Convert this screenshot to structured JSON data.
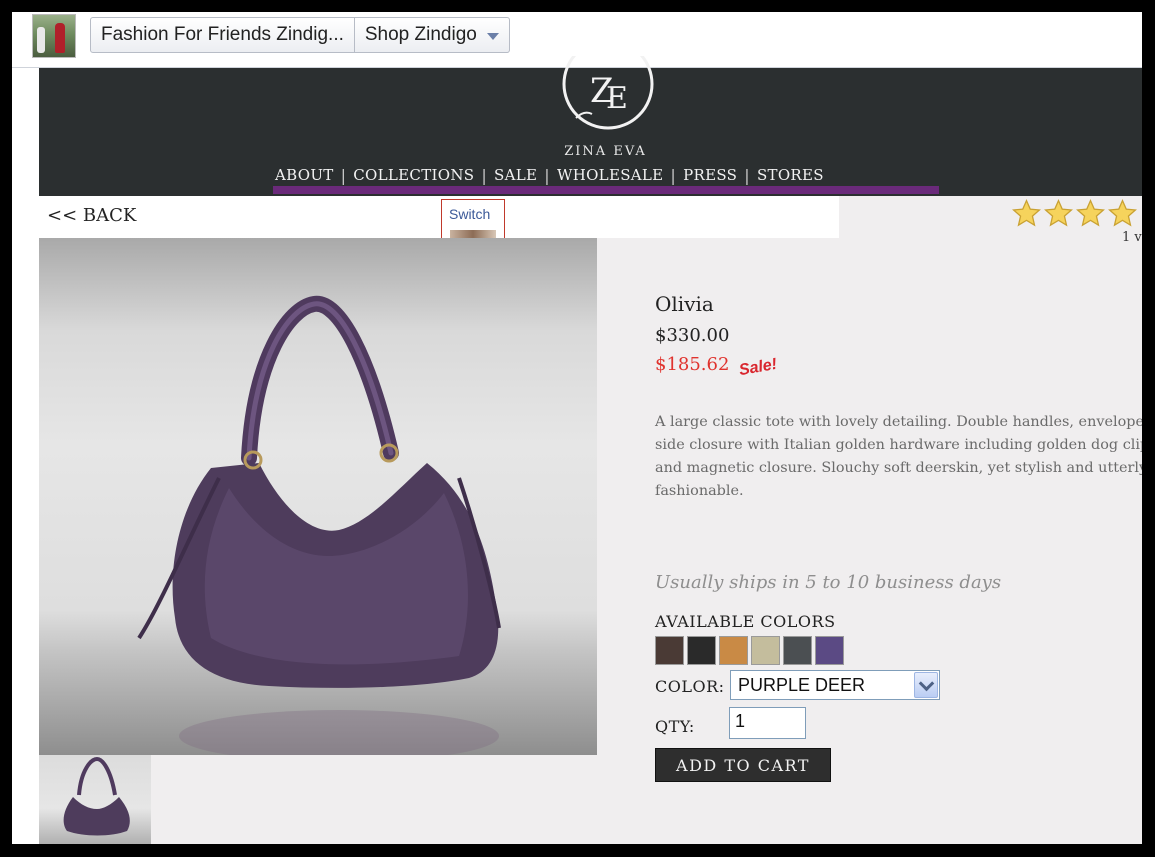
{
  "facebook_bar": {
    "page_tab": "Fashion For Friends Zindig...",
    "shop_tab": "Shop Zindigo"
  },
  "site": {
    "brand": "ZINA EVA",
    "nav": [
      "ABOUT",
      "COLLECTIONS",
      "SALE",
      "WHOLESALE",
      "PRESS",
      "STORES"
    ]
  },
  "page": {
    "back_label": "<< BACK",
    "switch_label": "Switch",
    "rating_stars": 4,
    "votes_text": "1 v"
  },
  "product": {
    "name": "Olivia",
    "original_price": "$330.00",
    "sale_price": "$185.62",
    "sale_tag": "Sale!",
    "description": "A large classic tote with lovely detailing. Double handles, envelope side closure with Italian golden hardware including golden dog clip and magnetic closure. Slouchy soft deerskin, yet stylish and utterly fashionable.",
    "shipping": "Usually ships in 5 to 10 business days",
    "colors_heading": "AVAILABLE COLORS",
    "swatches": [
      "#4a3a35",
      "#2a2a2a",
      "#c98a45",
      "#c4bd9d",
      "#4b4f52",
      "#5b4a84"
    ],
    "color_label": "COLOR:",
    "selected_color": "PURPLE DEER",
    "qty_label": "QTY:",
    "qty_value": "1",
    "add_to_cart": "ADD TO CART"
  }
}
